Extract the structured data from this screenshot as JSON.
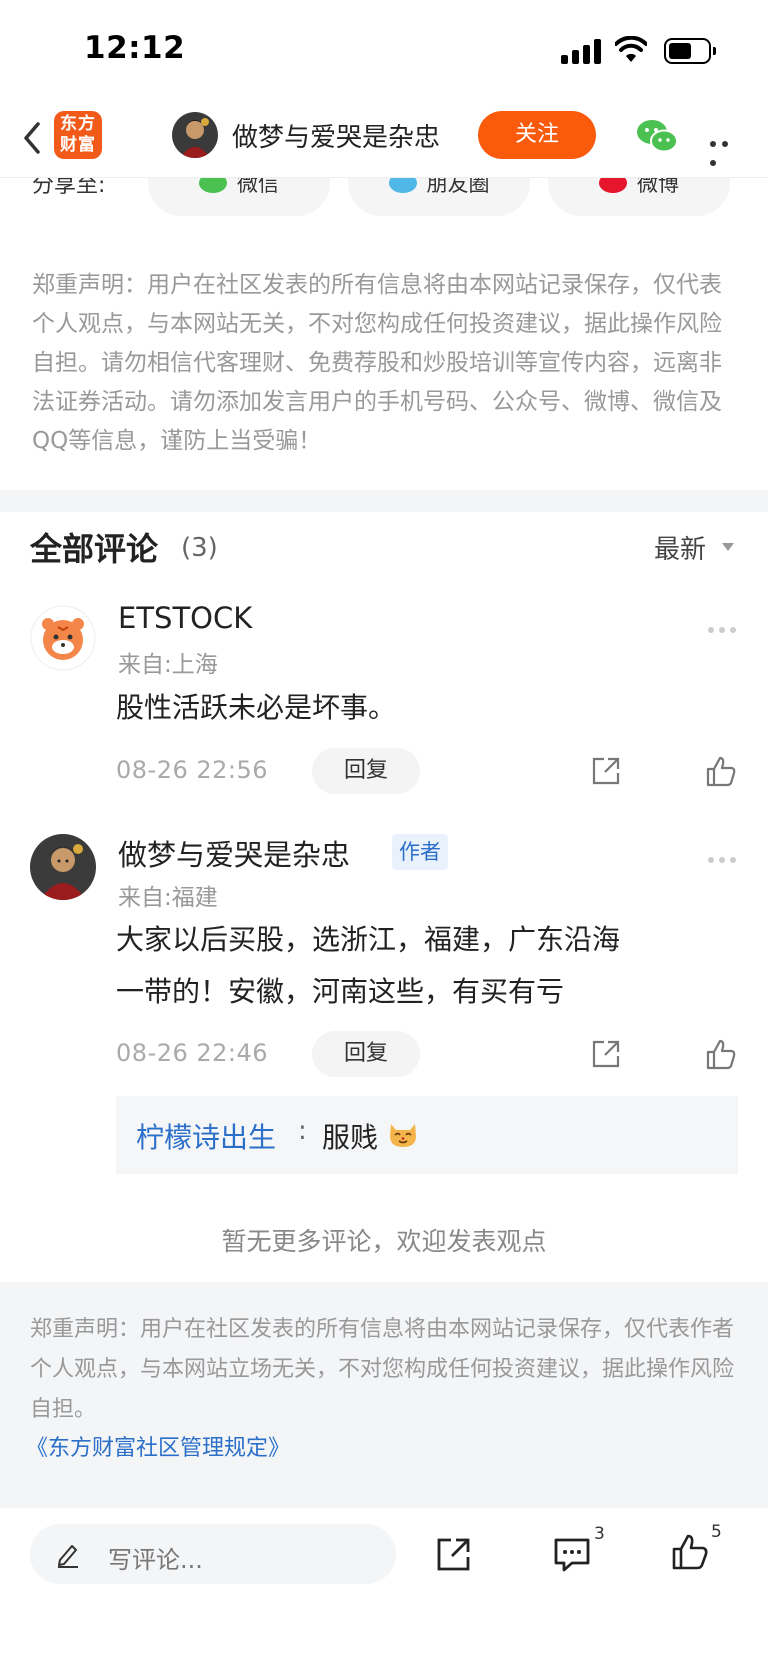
{
  "status_bar": {
    "time": "12:12"
  },
  "nav": {
    "logo_line1": "东方",
    "logo_line2": "财富",
    "title": "做梦与爱哭是杂忠",
    "follow_label": "关注"
  },
  "share": {
    "label": "分享至:",
    "options": [
      "微信",
      "朋友圈",
      "微博"
    ]
  },
  "disclaimer_top": "郑重声明：用户在社区发表的所有信息将由本网站记录保存，仅代表个人观点，与本网站无关，不对您构成任何投资建议，据此操作风险自担。请勿相信代客理财、免费荐股和炒股培训等宣传内容，远离非法证券活动。请勿添加发言用户的手机号码、公众号、微博、微信及QQ等信息，谨防上当受骗！",
  "comments_header": {
    "title": "全部评论",
    "count": "(3)",
    "sort": "最新"
  },
  "comments": [
    {
      "name": "ETSTOCK",
      "location": "来自:上海",
      "text": "股性活跃未必是坏事。",
      "time": "08-26 22:56",
      "reply_label": "回复"
    },
    {
      "name": "做梦与爱哭是杂忠",
      "author_tag": "作者",
      "location": "来自:福建",
      "text_line1": "大家以后买股，选浙江，福建，广东沿海",
      "text_line2": "一带的！安徽，河南这些，有买有亏",
      "time": "08-26 22:46",
      "reply_label": "回复",
      "sub_reply": {
        "user": "柠檬诗出生",
        "separator": ":",
        "text": "服贱"
      }
    }
  ],
  "no_more": "暂无更多评论，欢迎发表观点",
  "footer": {
    "text": "郑重声明：用户在社区发表的所有信息将由本网站记录保存，仅代表作者个人观点，与本网站立场无关，不对您构成任何投资建议，据此操作风险自担。",
    "link": "《东方财富社区管理规定》"
  },
  "bottom_bar": {
    "placeholder": "写评论...",
    "comment_count": "3",
    "like_count": "5"
  },
  "colors": {
    "accent": "#fa5a0c",
    "link": "#2b6fc9",
    "muted": "#999999"
  }
}
